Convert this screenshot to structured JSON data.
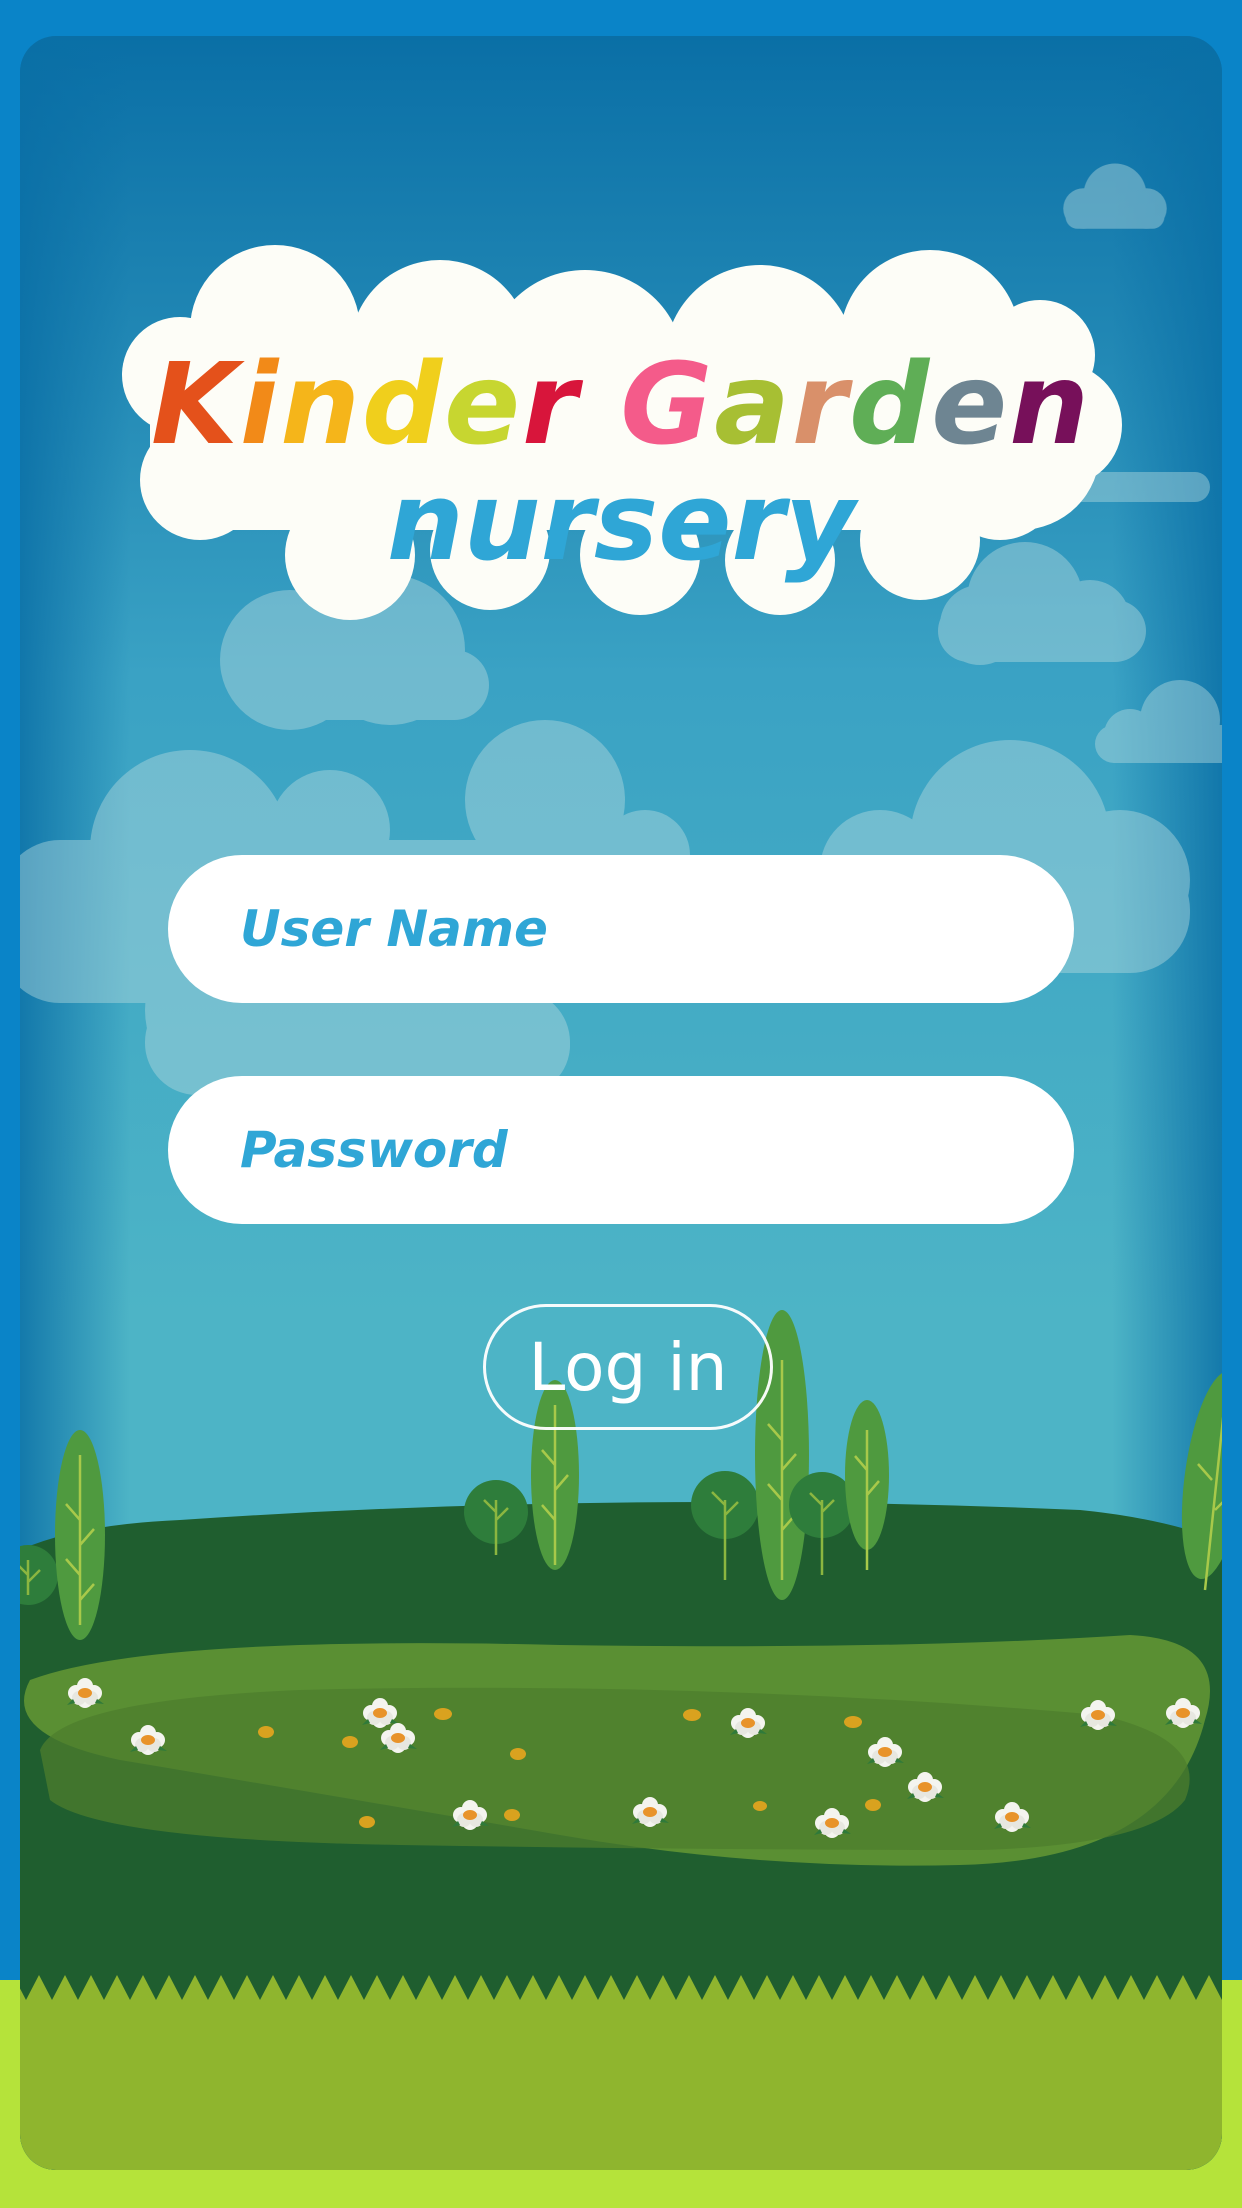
{
  "logo": {
    "line1_letters": [
      {
        "char": "K",
        "color": "#e4511b"
      },
      {
        "char": "i",
        "color": "#f28a18"
      },
      {
        "char": "n",
        "color": "#f5b51a"
      },
      {
        "char": "d",
        "color": "#f0cf1c"
      },
      {
        "char": "e",
        "color": "#c7d630"
      },
      {
        "char": "r",
        "color": "#d8153b"
      },
      {
        "char": " ",
        "color": "#ffffff"
      },
      {
        "char": "G",
        "color": "#f45b8a"
      },
      {
        "char": "a",
        "color": "#a7bf33"
      },
      {
        "char": "r",
        "color": "#d9906a"
      },
      {
        "char": "d",
        "color": "#5fae56"
      },
      {
        "char": "e",
        "color": "#6e8592"
      },
      {
        "char": "n",
        "color": "#77105a"
      }
    ],
    "line2": "nursery",
    "line2_color": "#2fa6d6"
  },
  "form": {
    "username_placeholder": "User Name",
    "password_placeholder": "Password",
    "login_label": "Log in"
  },
  "colors": {
    "sky_top": "#0a6fa6",
    "sky_bottom": "#4db4c6",
    "frame": "#0a84c8",
    "hill_dark": "#1f5e2f",
    "meadow": "#5a8f33",
    "grass_light": "#b5e33a",
    "cloud": "#fdfdf7",
    "accent_text": "#2fa6d6"
  }
}
